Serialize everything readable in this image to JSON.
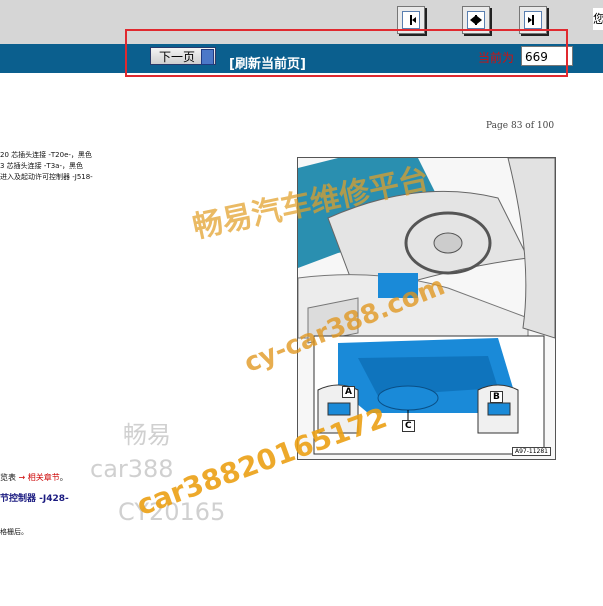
{
  "toolbar": {
    "buttons": [
      "first-page",
      "prev-next-page",
      "last-page"
    ],
    "cut_text": "您"
  },
  "nav": {
    "next_label": "下一页",
    "refresh_label": "[刷新当前页]",
    "current_label": "当前为",
    "current_value": "669"
  },
  "document": {
    "page_label": "Page 83 of 100",
    "lines": [
      "20 芯插头连接 -T20e-，黑色",
      "3 芯插头连接 -T3a-，黑色",
      "进入及起动许可控制器 -J518-"
    ],
    "link_prefix": "览表",
    "link_arrow": "→",
    "link_text": "相关章节",
    "link_suffix": "。",
    "heading": "节控制器 -J428-",
    "grille_text": "格栅后。"
  },
  "figure": {
    "code": "A97-11281",
    "callouts": {
      "a": "A",
      "b": "B",
      "c": "C"
    }
  },
  "watermarks": {
    "w1": "畅易汽车维修平台",
    "w2": "cy-car388.com",
    "w3": "car38820165172",
    "w4": "畅易",
    "w5": "car388",
    "w6": "CY20165"
  },
  "colors": {
    "blue_bar": "#0b5f8e",
    "highlight_box": "#e0292f",
    "figure_component": "#1a8ad8"
  }
}
